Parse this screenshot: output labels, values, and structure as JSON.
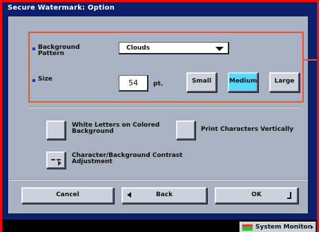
{
  "window": {
    "title": "Secure Watermark: Option"
  },
  "background_pattern": {
    "label": "Background Pattern",
    "selected_value": "Clouds"
  },
  "size": {
    "label": "Size",
    "value": "54",
    "unit": "pt.",
    "options": [
      "Small",
      "Medium",
      "Large"
    ],
    "selected": "Medium"
  },
  "options": {
    "white_letters_label": "White Letters on Colored Background",
    "vertical_label": "Print Characters Vertically",
    "contrast_label": "Character/Background Contrast Adjustment"
  },
  "footer": {
    "cancel_label": "Cancel",
    "back_label": "Back",
    "ok_label": "OK"
  },
  "status_bar": {
    "system_monitor_label": "System Monitor"
  },
  "colors": {
    "frame_blue": "#0b1f6b",
    "panel_gray": "#a9b2c0",
    "selected_cyan": "#5ad8f8",
    "highlight_orange": "#e35a2c",
    "outer_red": "#ff0000"
  }
}
